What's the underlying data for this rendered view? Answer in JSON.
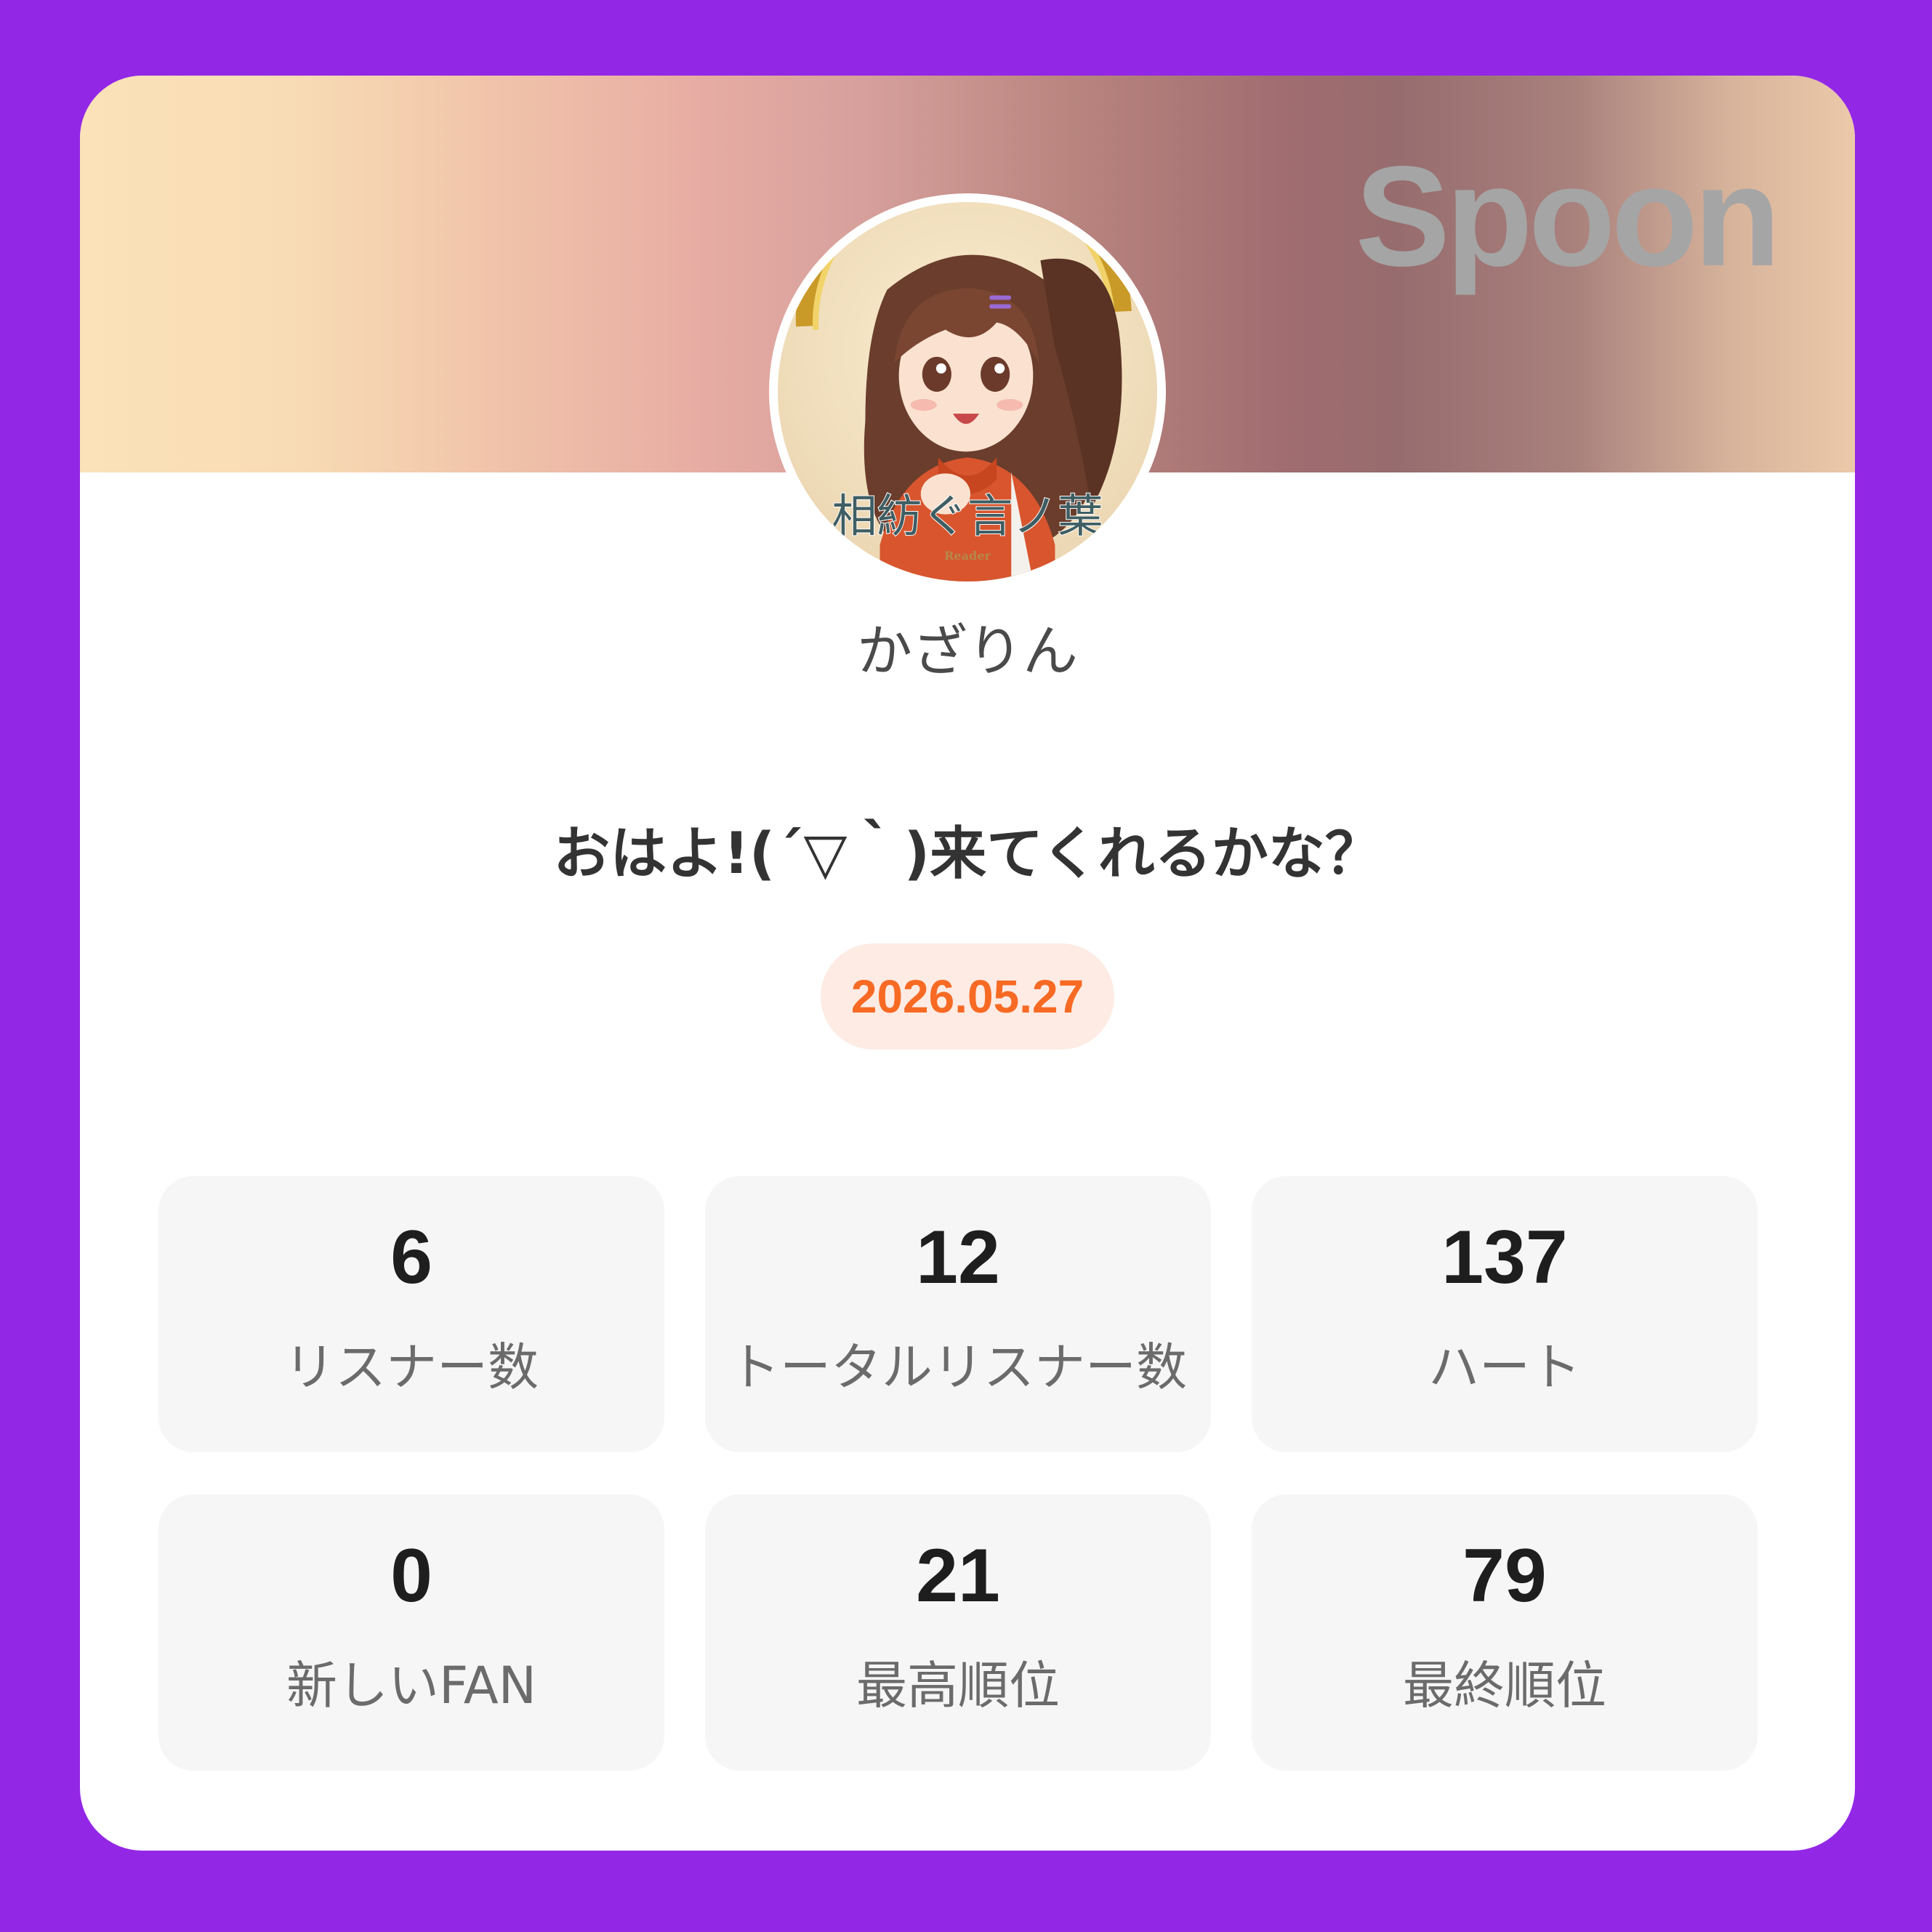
{
  "brand": "Spoon",
  "profile": {
    "username": "かざりん",
    "avatar_icon": "anime-girl-avatar",
    "avatar_caption": "相紡ぐ言ノ葉",
    "avatar_subcaption": "Reader"
  },
  "broadcast": {
    "title": "おはよ!(´▽｀)来てくれるかな？",
    "date": "2026.05.27"
  },
  "stats": [
    {
      "value": "6",
      "label": "リスナー数"
    },
    {
      "value": "12",
      "label": "トータルリスナー数"
    },
    {
      "value": "137",
      "label": "ハート"
    },
    {
      "value": "0",
      "label": "新しいFAN"
    },
    {
      "value": "21",
      "label": "最高順位"
    },
    {
      "value": "79",
      "label": "最終順位"
    }
  ],
  "colors": {
    "background": "#9327e6",
    "accent": "#f76a24",
    "date_pill_bg": "#fdebe4",
    "stat_bg": "#f6f6f6"
  }
}
